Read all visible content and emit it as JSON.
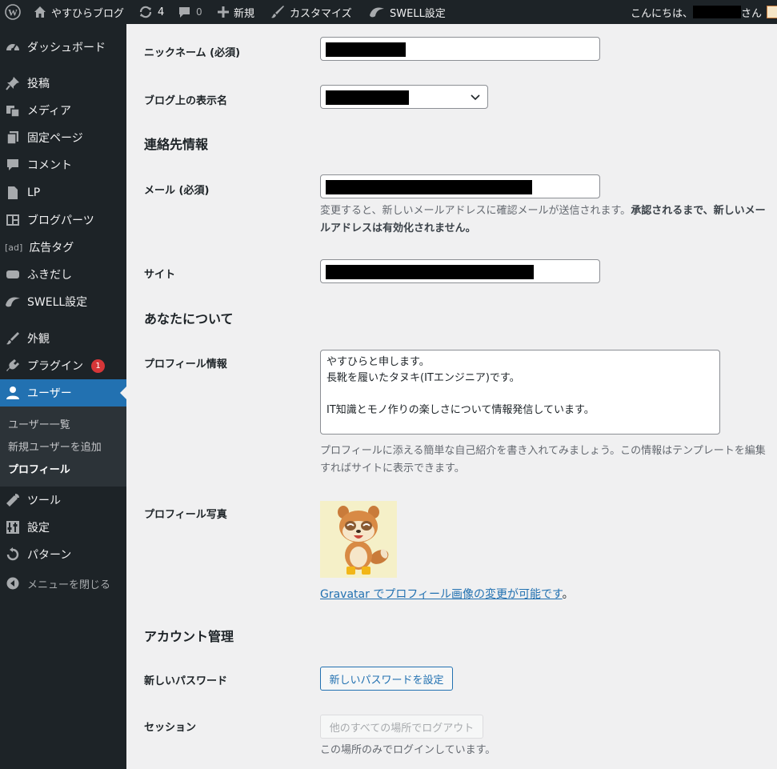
{
  "adminbar": {
    "site_name": "やすひらブログ",
    "updates_count": "4",
    "comments_count": "0",
    "new_label": "新規",
    "customize_label": "カスタマイズ",
    "swell_label": "SWELL設定",
    "greeting_prefix": "こんにちは、",
    "greeting_suffix": "さん"
  },
  "sidebar": {
    "items": [
      {
        "label": "ダッシュボード",
        "icon": "dashboard-icon"
      },
      {
        "label": "投稿",
        "icon": "pin-icon"
      },
      {
        "label": "メディア",
        "icon": "media-icon"
      },
      {
        "label": "固定ページ",
        "icon": "page-icon"
      },
      {
        "label": "コメント",
        "icon": "comment-icon"
      },
      {
        "label": "LP",
        "icon": "lp-page-icon"
      },
      {
        "label": "ブログパーツ",
        "icon": "blog-parts-icon"
      },
      {
        "label": "広告タグ",
        "icon": "ad-icon",
        "glyph": "[ad]"
      },
      {
        "label": "ふきだし",
        "icon": "balloon-icon"
      },
      {
        "label": "SWELL設定",
        "icon": "swell-icon"
      },
      {
        "label": "外観",
        "icon": "appearance-icon"
      },
      {
        "label": "プラグイン",
        "icon": "plugin-icon",
        "badge": "1"
      },
      {
        "label": "ユーザー",
        "icon": "user-icon"
      },
      {
        "label": "ツール",
        "icon": "tools-icon"
      },
      {
        "label": "設定",
        "icon": "settings-icon"
      },
      {
        "label": "パターン",
        "icon": "pattern-icon"
      },
      {
        "label": "メニューを閉じる",
        "icon": "collapse-icon"
      }
    ],
    "submenu": [
      {
        "label": "ユーザー一覧"
      },
      {
        "label": "新規ユーザーを追加"
      },
      {
        "label": "プロフィール"
      }
    ]
  },
  "form": {
    "nickname_label": "ニックネーム (必須)",
    "display_name_label": "ブログ上の表示名",
    "contact_title": "連絡先情報",
    "email_label": "メール (必須)",
    "email_desc_1": "変更すると、新しいメールアドレスに確認メールが送信されます。",
    "email_desc_bold": "承認されるまで、新しいメールアドレスは有効化されません。",
    "site_label": "サイト",
    "about_title": "あなたについて",
    "bio_label": "プロフィール情報",
    "bio_value": "やすひらと申します。\n長靴を履いたタヌキ(ITエンジニア)です。\n\nIT知識とモノ作りの楽しさについて情報発信しています。",
    "bio_desc": "プロフィールに添える簡単な自己紹介を書き入れてみましょう。この情報はテンプレートを編集すればサイトに表示できます。",
    "photo_label": "プロフィール写真",
    "gravatar_link": "Gravatar でプロフィール画像の変更が可能です",
    "gravatar_suffix": "。",
    "account_title": "アカウント管理",
    "password_label": "新しいパスワード",
    "password_button": "新しいパスワードを設定",
    "session_label": "セッション",
    "logout_button": "他のすべての場所でログアウト",
    "session_desc": "この場所のみでログインしています。"
  },
  "colors": {
    "admin_bg": "#1d2327",
    "accent": "#2271b1",
    "badge": "#d63638",
    "content_bg": "#f0f0f1"
  }
}
